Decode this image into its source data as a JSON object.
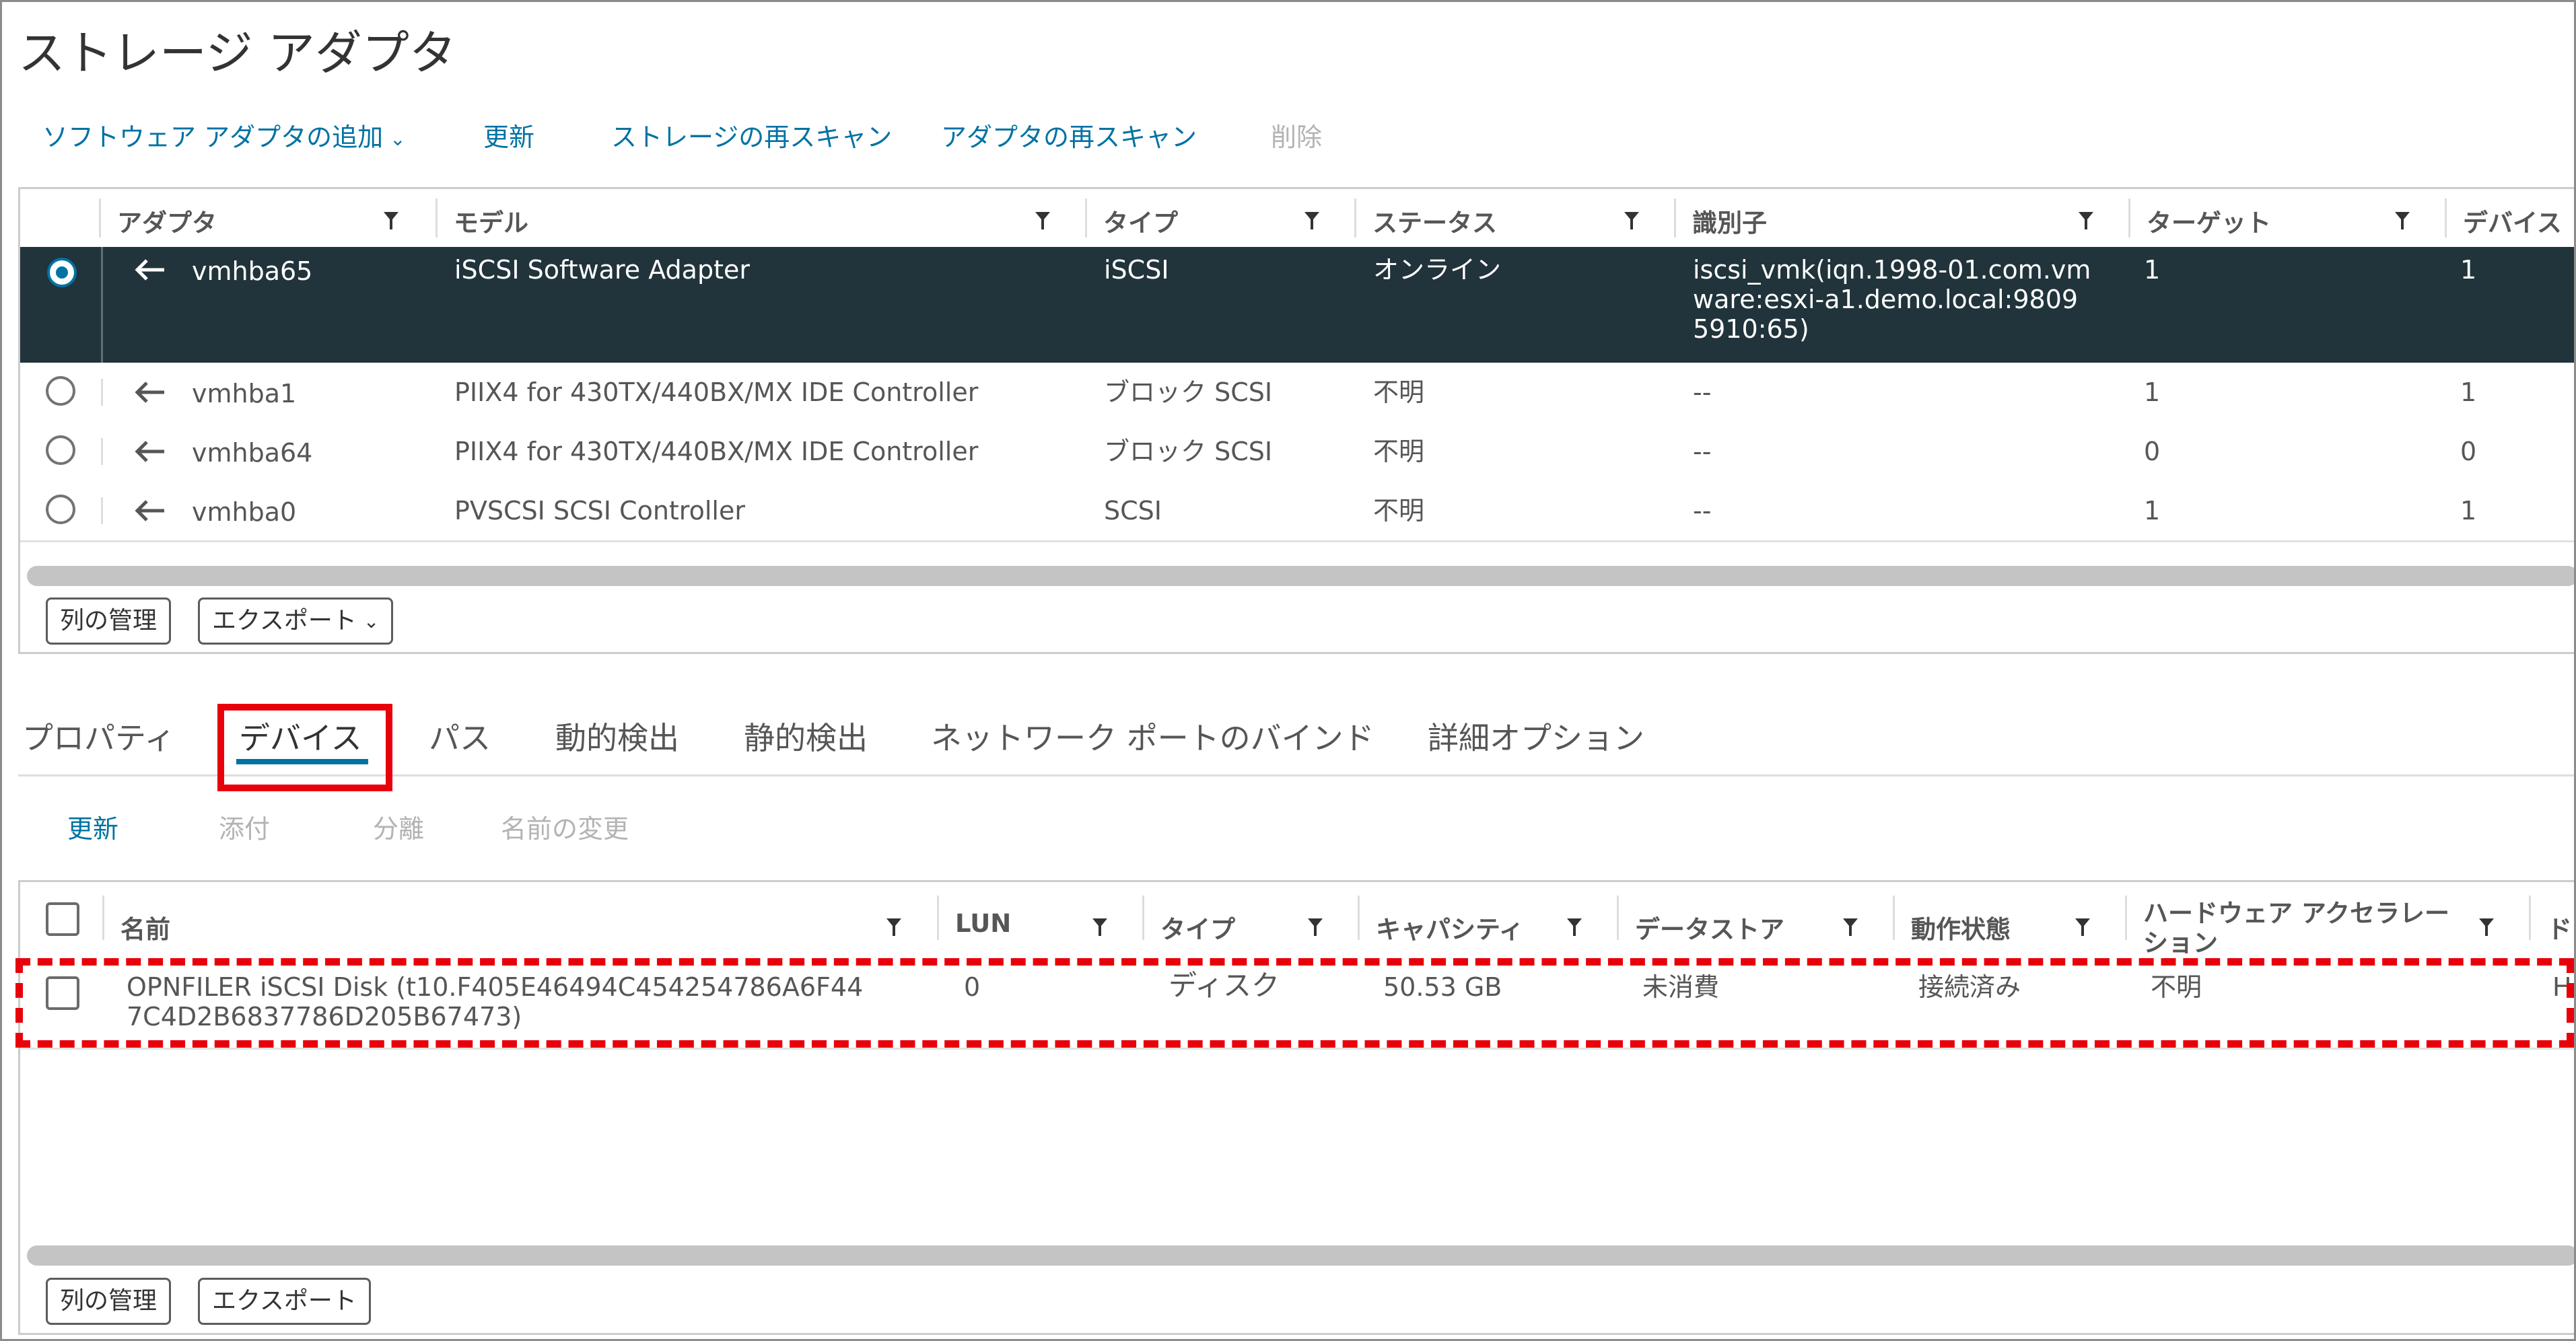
{
  "title": "ストレージ アダプタ",
  "toolbar": {
    "add_software_adapter": "ソフトウェア アダプタの追加",
    "refresh": "更新",
    "rescan_storage": "ストレージの再スキャン",
    "rescan_adapter": "アダプタの再スキャン",
    "remove": "削除"
  },
  "adapter_grid": {
    "columns": [
      "アダプタ",
      "モデル",
      "タイプ",
      "ステータス",
      "識別子",
      "ターゲット",
      "デバイス"
    ],
    "rows": [
      {
        "selected": true,
        "adapter": "vmhba65",
        "model": "iSCSI Software Adapter",
        "type": "iSCSI",
        "status": "オンライン",
        "identifier_lines": [
          "iscsi_vmk(iqn.1998-01.com.vm",
          "ware:esxi-a1.demo.local:9809",
          "5910:65)"
        ],
        "targets": "1",
        "devices": "1"
      },
      {
        "selected": false,
        "adapter": "vmhba1",
        "model": "PIIX4 for 430TX/440BX/MX IDE Controller",
        "type": "ブロック SCSI",
        "status": "不明",
        "identifier_lines": [
          "--"
        ],
        "targets": "1",
        "devices": "1"
      },
      {
        "selected": false,
        "adapter": "vmhba64",
        "model": "PIIX4 for 430TX/440BX/MX IDE Controller",
        "type": "ブロック SCSI",
        "status": "不明",
        "identifier_lines": [
          "--"
        ],
        "targets": "0",
        "devices": "0"
      },
      {
        "selected": false,
        "adapter": "vmhba0",
        "model": "PVSCSI SCSI Controller",
        "type": "SCSI",
        "status": "不明",
        "identifier_lines": [
          "--"
        ],
        "targets": "1",
        "devices": "1"
      }
    ],
    "footer": {
      "manage_columns": "列の管理",
      "export": "エクスポート"
    }
  },
  "tabs": [
    "プロパティ",
    "デバイス",
    "パス",
    "動的検出",
    "静的検出",
    "ネットワーク ポートのバインド",
    "詳細オプション"
  ],
  "active_tab": "デバイス",
  "device_toolbar": {
    "refresh": "更新",
    "attach": "添付",
    "detach": "分離",
    "rename": "名前の変更"
  },
  "device_grid": {
    "columns": [
      "名前",
      "LUN",
      "タイプ",
      "キャパシティ",
      "データストア",
      "動作状態",
      "ハードウェア アクセラレー|ション",
      "ド"
    ],
    "rows": [
      {
        "name_lines": [
          "OPNFILER iSCSI Disk (t10.F405E46494C454254786A6F44",
          "7C4D2B6837786D205B67473)"
        ],
        "lun": "0",
        "type": "ディスク",
        "capacity": "50.53 GB",
        "datastore": "未消費",
        "state": "接続済み",
        "hw_accel": "不明",
        "drive_type": "H"
      }
    ],
    "footer": {
      "manage_columns": "列の管理",
      "export": "エクスポート"
    }
  },
  "colors": {
    "link": "#0072a3",
    "selected_row": "#21333b",
    "highlight": "#e8000b"
  }
}
